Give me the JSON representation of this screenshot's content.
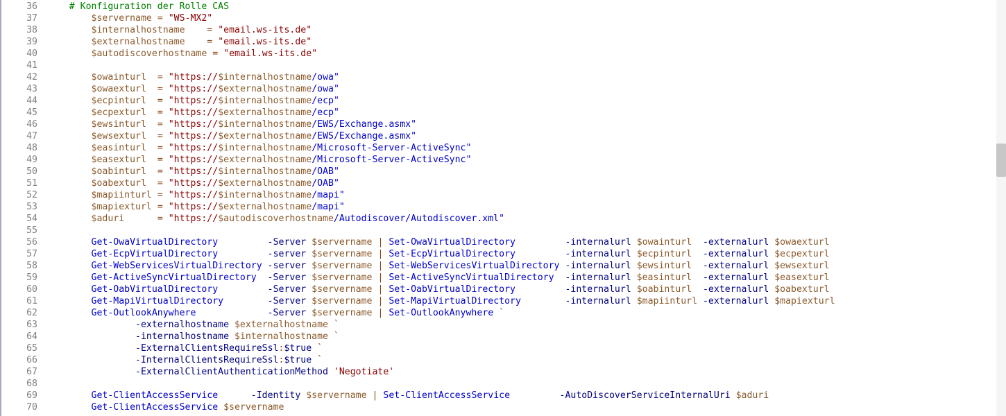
{
  "first_line": 36,
  "lines": [
    {
      "n": 36,
      "t": [
        [
          "    ",
          ""
        ],
        [
          "# Konfiguration der Rolle CAS",
          "comment"
        ]
      ]
    },
    {
      "n": 37,
      "t": [
        [
          "        ",
          ""
        ],
        [
          "$servername",
          "var"
        ],
        [
          " ",
          "op"
        ],
        [
          "=",
          "op"
        ],
        [
          " ",
          ""
        ],
        [
          "\"WS-MX2\"",
          "str"
        ]
      ]
    },
    {
      "n": 38,
      "t": [
        [
          "        ",
          ""
        ],
        [
          "$internalhostname",
          "var"
        ],
        [
          "    ",
          ""
        ],
        [
          "=",
          "op"
        ],
        [
          " ",
          ""
        ],
        [
          "\"email.ws-its.de\"",
          "str"
        ]
      ]
    },
    {
      "n": 39,
      "t": [
        [
          "        ",
          ""
        ],
        [
          "$externalhostname",
          "var"
        ],
        [
          "    ",
          ""
        ],
        [
          "=",
          "op"
        ],
        [
          " ",
          ""
        ],
        [
          "\"email.ws-its.de\"",
          "str"
        ]
      ]
    },
    {
      "n": 40,
      "t": [
        [
          "        ",
          ""
        ],
        [
          "$autodiscoverhostname",
          "var"
        ],
        [
          " ",
          ""
        ],
        [
          "=",
          "op"
        ],
        [
          " ",
          ""
        ],
        [
          "\"email.ws-its.de\"",
          "str"
        ]
      ]
    },
    {
      "n": 41,
      "t": [
        [
          "",
          ""
        ]
      ]
    },
    {
      "n": 42,
      "t": [
        [
          "        ",
          ""
        ],
        [
          "$owainturl",
          "var"
        ],
        [
          "  ",
          ""
        ],
        [
          "=",
          "op"
        ],
        [
          " ",
          ""
        ],
        [
          "\"https://",
          "str"
        ],
        [
          "$internalhostname",
          "var"
        ],
        [
          "/owa\"",
          "path"
        ]
      ]
    },
    {
      "n": 43,
      "t": [
        [
          "        ",
          ""
        ],
        [
          "$owaexturl",
          "var"
        ],
        [
          "  ",
          ""
        ],
        [
          "=",
          "op"
        ],
        [
          " ",
          ""
        ],
        [
          "\"https://",
          "str"
        ],
        [
          "$externalhostname",
          "var"
        ],
        [
          "/owa\"",
          "path"
        ]
      ]
    },
    {
      "n": 44,
      "t": [
        [
          "        ",
          ""
        ],
        [
          "$ecpinturl",
          "var"
        ],
        [
          "  ",
          ""
        ],
        [
          "=",
          "op"
        ],
        [
          " ",
          ""
        ],
        [
          "\"https://",
          "str"
        ],
        [
          "$internalhostname",
          "var"
        ],
        [
          "/ecp\"",
          "path"
        ]
      ]
    },
    {
      "n": 45,
      "t": [
        [
          "        ",
          ""
        ],
        [
          "$ecpexturl",
          "var"
        ],
        [
          "  ",
          ""
        ],
        [
          "=",
          "op"
        ],
        [
          " ",
          ""
        ],
        [
          "\"https://",
          "str"
        ],
        [
          "$externalhostname",
          "var"
        ],
        [
          "/ecp\"",
          "path"
        ]
      ]
    },
    {
      "n": 46,
      "t": [
        [
          "        ",
          ""
        ],
        [
          "$ewsinturl",
          "var"
        ],
        [
          "  ",
          ""
        ],
        [
          "=",
          "op"
        ],
        [
          " ",
          ""
        ],
        [
          "\"https://",
          "str"
        ],
        [
          "$internalhostname",
          "var"
        ],
        [
          "/EWS/Exchange.asmx\"",
          "path"
        ]
      ]
    },
    {
      "n": 47,
      "t": [
        [
          "        ",
          ""
        ],
        [
          "$ewsexturl",
          "var"
        ],
        [
          "  ",
          ""
        ],
        [
          "=",
          "op"
        ],
        [
          " ",
          ""
        ],
        [
          "\"https://",
          "str"
        ],
        [
          "$externalhostname",
          "var"
        ],
        [
          "/EWS/Exchange.asmx\"",
          "path"
        ]
      ]
    },
    {
      "n": 48,
      "t": [
        [
          "        ",
          ""
        ],
        [
          "$easinturl",
          "var"
        ],
        [
          "  ",
          ""
        ],
        [
          "=",
          "op"
        ],
        [
          " ",
          ""
        ],
        [
          "\"https://",
          "str"
        ],
        [
          "$internalhostname",
          "var"
        ],
        [
          "/Microsoft-Server-ActiveSync\"",
          "path"
        ]
      ]
    },
    {
      "n": 49,
      "t": [
        [
          "        ",
          ""
        ],
        [
          "$easexturl",
          "var"
        ],
        [
          "  ",
          ""
        ],
        [
          "=",
          "op"
        ],
        [
          " ",
          ""
        ],
        [
          "\"https://",
          "str"
        ],
        [
          "$externalhostname",
          "var"
        ],
        [
          "/Microsoft-Server-ActiveSync\"",
          "path"
        ]
      ]
    },
    {
      "n": 50,
      "t": [
        [
          "        ",
          ""
        ],
        [
          "$oabinturl",
          "var"
        ],
        [
          "  ",
          ""
        ],
        [
          "=",
          "op"
        ],
        [
          " ",
          ""
        ],
        [
          "\"https://",
          "str"
        ],
        [
          "$internalhostname",
          "var"
        ],
        [
          "/OAB\"",
          "path"
        ]
      ]
    },
    {
      "n": 51,
      "t": [
        [
          "        ",
          ""
        ],
        [
          "$oabexturl",
          "var"
        ],
        [
          "  ",
          ""
        ],
        [
          "=",
          "op"
        ],
        [
          " ",
          ""
        ],
        [
          "\"https://",
          "str"
        ],
        [
          "$externalhostname",
          "var"
        ],
        [
          "/OAB\"",
          "path"
        ]
      ]
    },
    {
      "n": 52,
      "t": [
        [
          "        ",
          ""
        ],
        [
          "$mapiinturl",
          "var"
        ],
        [
          " ",
          ""
        ],
        [
          "=",
          "op"
        ],
        [
          " ",
          ""
        ],
        [
          "\"https://",
          "str"
        ],
        [
          "$internalhostname",
          "var"
        ],
        [
          "/mapi\"",
          "path"
        ]
      ]
    },
    {
      "n": 53,
      "t": [
        [
          "        ",
          ""
        ],
        [
          "$mapiexturl",
          "var"
        ],
        [
          " ",
          ""
        ],
        [
          "=",
          "op"
        ],
        [
          " ",
          ""
        ],
        [
          "\"https://",
          "str"
        ],
        [
          "$externalhostname",
          "var"
        ],
        [
          "/mapi\"",
          "path"
        ]
      ]
    },
    {
      "n": 54,
      "t": [
        [
          "        ",
          ""
        ],
        [
          "$aduri",
          "var"
        ],
        [
          "      ",
          ""
        ],
        [
          "=",
          "op"
        ],
        [
          " ",
          ""
        ],
        [
          "\"https://",
          "str"
        ],
        [
          "$autodiscoverhostname",
          "var"
        ],
        [
          "/Autodiscover/Autodiscover.xml\"",
          "path"
        ]
      ]
    },
    {
      "n": 55,
      "t": [
        [
          "",
          ""
        ]
      ]
    },
    {
      "n": 56,
      "t": [
        [
          "        ",
          ""
        ],
        [
          "Get-OwaVirtualDirectory",
          "cmd"
        ],
        [
          "         ",
          ""
        ],
        [
          "-Server",
          "param"
        ],
        [
          " ",
          ""
        ],
        [
          "$servername",
          "var"
        ],
        [
          " ",
          ""
        ],
        [
          "|",
          "op"
        ],
        [
          " ",
          ""
        ],
        [
          "Set-OwaVirtualDirectory",
          "cmd"
        ],
        [
          "         ",
          ""
        ],
        [
          "-internalurl",
          "param"
        ],
        [
          " ",
          ""
        ],
        [
          "$owainturl",
          "var"
        ],
        [
          "  ",
          ""
        ],
        [
          "-externalurl",
          "param"
        ],
        [
          " ",
          ""
        ],
        [
          "$owaexturl",
          "var"
        ]
      ]
    },
    {
      "n": 57,
      "t": [
        [
          "        ",
          ""
        ],
        [
          "Get-EcpVirtualDirectory",
          "cmd"
        ],
        [
          "         ",
          ""
        ],
        [
          "-server",
          "param"
        ],
        [
          " ",
          ""
        ],
        [
          "$servername",
          "var"
        ],
        [
          " ",
          ""
        ],
        [
          "|",
          "op"
        ],
        [
          " ",
          ""
        ],
        [
          "Set-EcpVirtualDirectory",
          "cmd"
        ],
        [
          "         ",
          ""
        ],
        [
          "-internalurl",
          "param"
        ],
        [
          " ",
          ""
        ],
        [
          "$ecpinturl",
          "var"
        ],
        [
          "  ",
          ""
        ],
        [
          "-externalurl",
          "param"
        ],
        [
          " ",
          ""
        ],
        [
          "$ecpexturl",
          "var"
        ]
      ]
    },
    {
      "n": 58,
      "t": [
        [
          "        ",
          ""
        ],
        [
          "Get-WebServicesVirtualDirectory",
          "cmd"
        ],
        [
          " ",
          ""
        ],
        [
          "-server",
          "param"
        ],
        [
          " ",
          ""
        ],
        [
          "$servername",
          "var"
        ],
        [
          " ",
          ""
        ],
        [
          "|",
          "op"
        ],
        [
          " ",
          ""
        ],
        [
          "Set-WebServicesVirtualDirectory",
          "cmd"
        ],
        [
          " ",
          ""
        ],
        [
          "-internalurl",
          "param"
        ],
        [
          " ",
          ""
        ],
        [
          "$ewsinturl",
          "var"
        ],
        [
          "  ",
          ""
        ],
        [
          "-externalurl",
          "param"
        ],
        [
          " ",
          ""
        ],
        [
          "$ewsexturl",
          "var"
        ]
      ]
    },
    {
      "n": 59,
      "t": [
        [
          "        ",
          ""
        ],
        [
          "Get-ActiveSyncVirtualDirectory",
          "cmd"
        ],
        [
          "  ",
          ""
        ],
        [
          "-Server",
          "param"
        ],
        [
          " ",
          ""
        ],
        [
          "$servername",
          "var"
        ],
        [
          " ",
          ""
        ],
        [
          "|",
          "op"
        ],
        [
          " ",
          ""
        ],
        [
          "Set-ActiveSyncVirtualDirectory",
          "cmd"
        ],
        [
          "  ",
          ""
        ],
        [
          "-internalurl",
          "param"
        ],
        [
          " ",
          ""
        ],
        [
          "$easinturl",
          "var"
        ],
        [
          "  ",
          ""
        ],
        [
          "-externalurl",
          "param"
        ],
        [
          " ",
          ""
        ],
        [
          "$easexturl",
          "var"
        ]
      ]
    },
    {
      "n": 60,
      "t": [
        [
          "        ",
          ""
        ],
        [
          "Get-OabVirtualDirectory",
          "cmd"
        ],
        [
          "         ",
          ""
        ],
        [
          "-Server",
          "param"
        ],
        [
          " ",
          ""
        ],
        [
          "$servername",
          "var"
        ],
        [
          " ",
          ""
        ],
        [
          "|",
          "op"
        ],
        [
          " ",
          ""
        ],
        [
          "Set-OabVirtualDirectory",
          "cmd"
        ],
        [
          "         ",
          ""
        ],
        [
          "-internalurl",
          "param"
        ],
        [
          " ",
          ""
        ],
        [
          "$oabinturl",
          "var"
        ],
        [
          "  ",
          ""
        ],
        [
          "-externalurl",
          "param"
        ],
        [
          " ",
          ""
        ],
        [
          "$oabexturl",
          "var"
        ]
      ]
    },
    {
      "n": 61,
      "t": [
        [
          "        ",
          ""
        ],
        [
          "Get-MapiVirtualDirectory",
          "cmd"
        ],
        [
          "        ",
          ""
        ],
        [
          "-Server",
          "param"
        ],
        [
          " ",
          ""
        ],
        [
          "$servername",
          "var"
        ],
        [
          " ",
          ""
        ],
        [
          "|",
          "op"
        ],
        [
          " ",
          ""
        ],
        [
          "Set-MapiVirtualDirectory",
          "cmd"
        ],
        [
          "        ",
          ""
        ],
        [
          "-internalurl",
          "param"
        ],
        [
          " ",
          ""
        ],
        [
          "$mapiinturl",
          "var"
        ],
        [
          " ",
          ""
        ],
        [
          "-externalurl",
          "param"
        ],
        [
          " ",
          ""
        ],
        [
          "$mapiexturl",
          "var"
        ]
      ]
    },
    {
      "n": 62,
      "t": [
        [
          "        ",
          ""
        ],
        [
          "Get-OutlookAnywhere",
          "cmd"
        ],
        [
          "             ",
          ""
        ],
        [
          "-Server",
          "param"
        ],
        [
          " ",
          ""
        ],
        [
          "$servername",
          "var"
        ],
        [
          " ",
          ""
        ],
        [
          "|",
          "op"
        ],
        [
          " ",
          ""
        ],
        [
          "Set-OutlookAnywhere",
          "cmd"
        ],
        [
          " ",
          ""
        ],
        [
          "`",
          "op"
        ]
      ]
    },
    {
      "n": 63,
      "t": [
        [
          "                ",
          ""
        ],
        [
          "-externalhostname",
          "param"
        ],
        [
          " ",
          ""
        ],
        [
          "$externalhostname",
          "var"
        ],
        [
          " ",
          ""
        ],
        [
          "`",
          "op"
        ]
      ]
    },
    {
      "n": 64,
      "t": [
        [
          "                ",
          ""
        ],
        [
          "-internalhostname",
          "param"
        ],
        [
          " ",
          ""
        ],
        [
          "$internalhostname",
          "var"
        ],
        [
          " ",
          ""
        ],
        [
          "`",
          "op"
        ]
      ]
    },
    {
      "n": 65,
      "t": [
        [
          "                ",
          ""
        ],
        [
          "-ExternalClientsRequireSsl",
          "param"
        ],
        [
          ":",
          "op"
        ],
        [
          "$true",
          "kw"
        ],
        [
          " ",
          ""
        ],
        [
          "`",
          "op"
        ]
      ]
    },
    {
      "n": 66,
      "t": [
        [
          "                ",
          ""
        ],
        [
          "-InternalClientsRequireSsl",
          "param"
        ],
        [
          ":",
          "op"
        ],
        [
          "$true",
          "kw"
        ],
        [
          " ",
          ""
        ],
        [
          "`",
          "op"
        ]
      ]
    },
    {
      "n": 67,
      "t": [
        [
          "                ",
          ""
        ],
        [
          "-ExternalClientAuthenticationMethod",
          "param"
        ],
        [
          " ",
          ""
        ],
        [
          "'Negotiate'",
          "str"
        ]
      ]
    },
    {
      "n": 68,
      "t": [
        [
          "",
          ""
        ]
      ]
    },
    {
      "n": 69,
      "t": [
        [
          "        ",
          ""
        ],
        [
          "Get-ClientAccessService",
          "cmd"
        ],
        [
          "      ",
          ""
        ],
        [
          "-Identity",
          "param"
        ],
        [
          " ",
          ""
        ],
        [
          "$servername",
          "var"
        ],
        [
          " ",
          ""
        ],
        [
          "|",
          "op"
        ],
        [
          " ",
          ""
        ],
        [
          "Set-ClientAccessService",
          "cmd"
        ],
        [
          "         ",
          ""
        ],
        [
          "-AutoDiscoverServiceInternalUri",
          "param"
        ],
        [
          " ",
          ""
        ],
        [
          "$aduri",
          "var"
        ]
      ]
    },
    {
      "n": 70,
      "t": [
        [
          "        ",
          ""
        ],
        [
          "Get-ClientAccessService",
          "cmd"
        ],
        [
          " ",
          ""
        ],
        [
          "$servername",
          "var"
        ]
      ]
    }
  ]
}
